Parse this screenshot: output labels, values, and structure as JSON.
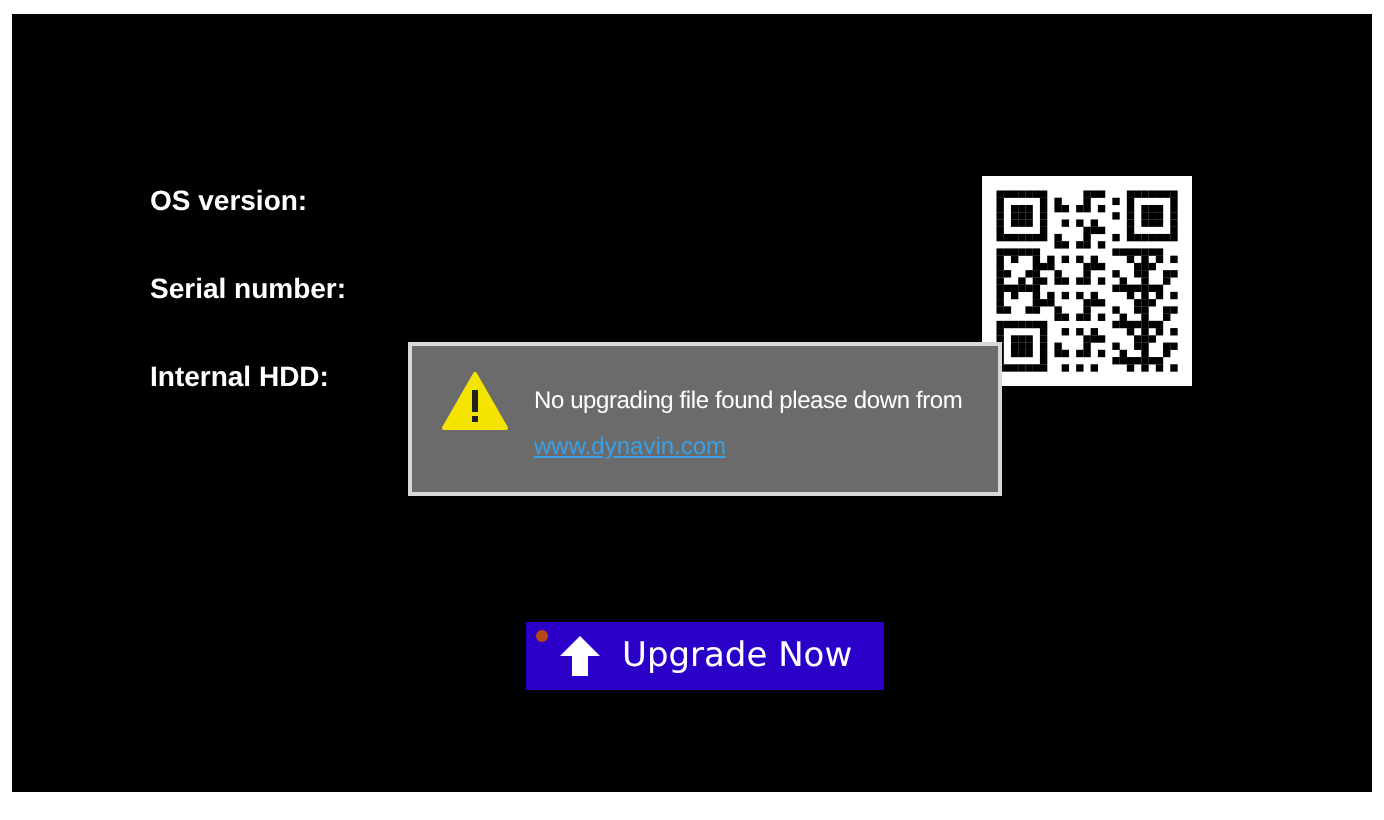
{
  "info_labels": [
    "OS version:",
    "Serial number:",
    "Internal HDD:"
  ],
  "dialog": {
    "message": "No upgrading file found please down from",
    "link": "www.dynavin.com"
  },
  "upgrade_button": {
    "label": "Upgrade Now"
  }
}
